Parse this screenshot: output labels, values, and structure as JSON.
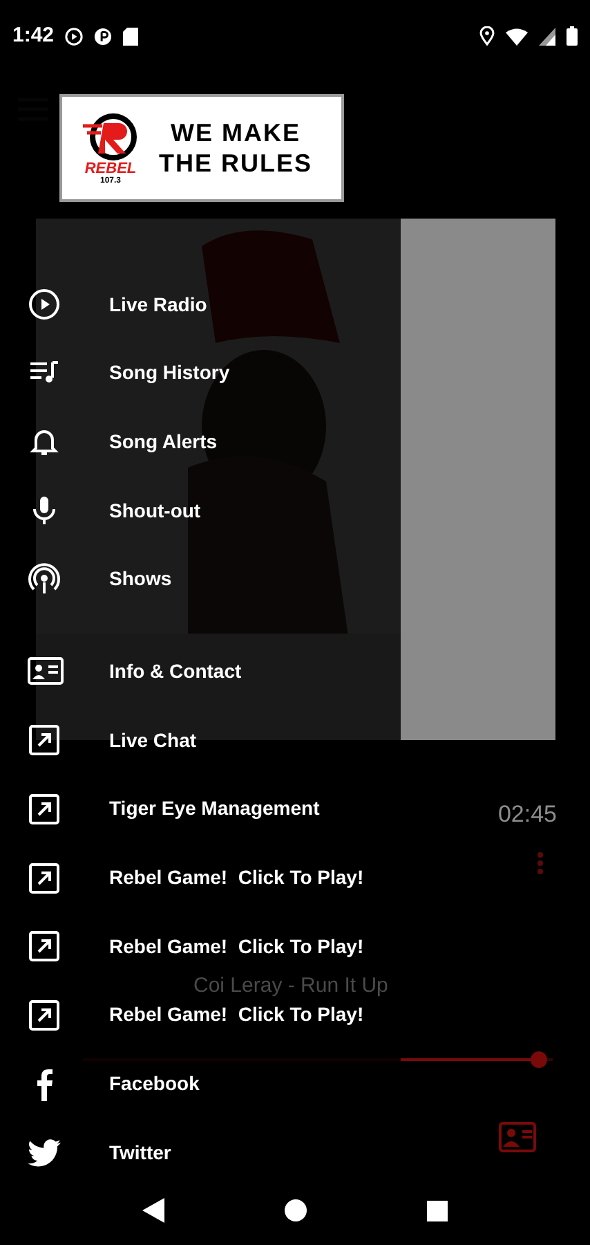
{
  "status_bar": {
    "time": "1:42"
  },
  "logo": {
    "brand": "REBEL",
    "frequency": "107.3",
    "slogan_line_1": "WE MAKE",
    "slogan_line_2": "THE RULES"
  },
  "player": {
    "track": "Coi Leray - Run It Up",
    "duration": "02:45",
    "level": 0.97
  },
  "menu": [
    {
      "label": "Live Radio",
      "kind": "play"
    },
    {
      "label": "Song History",
      "kind": "history"
    },
    {
      "label": "Song Alerts",
      "kind": "bell"
    },
    {
      "label": "Shout-out",
      "kind": "mic"
    },
    {
      "label": "Shows",
      "kind": "podcast"
    },
    {
      "label": "Info & Contact",
      "kind": "contact"
    },
    {
      "label": "Live Chat",
      "kind": "external"
    },
    {
      "label": "Tiger Eye Management",
      "kind": "external"
    },
    {
      "label": "Rebel Game!  Click To Play!",
      "kind": "external"
    },
    {
      "label": "Rebel Game!  Click To Play!",
      "kind": "external"
    },
    {
      "label": "Rebel Game!  Click To Play!",
      "kind": "external"
    },
    {
      "label": "Facebook",
      "kind": "facebook"
    },
    {
      "label": "Twitter",
      "kind": "twitter"
    }
  ]
}
